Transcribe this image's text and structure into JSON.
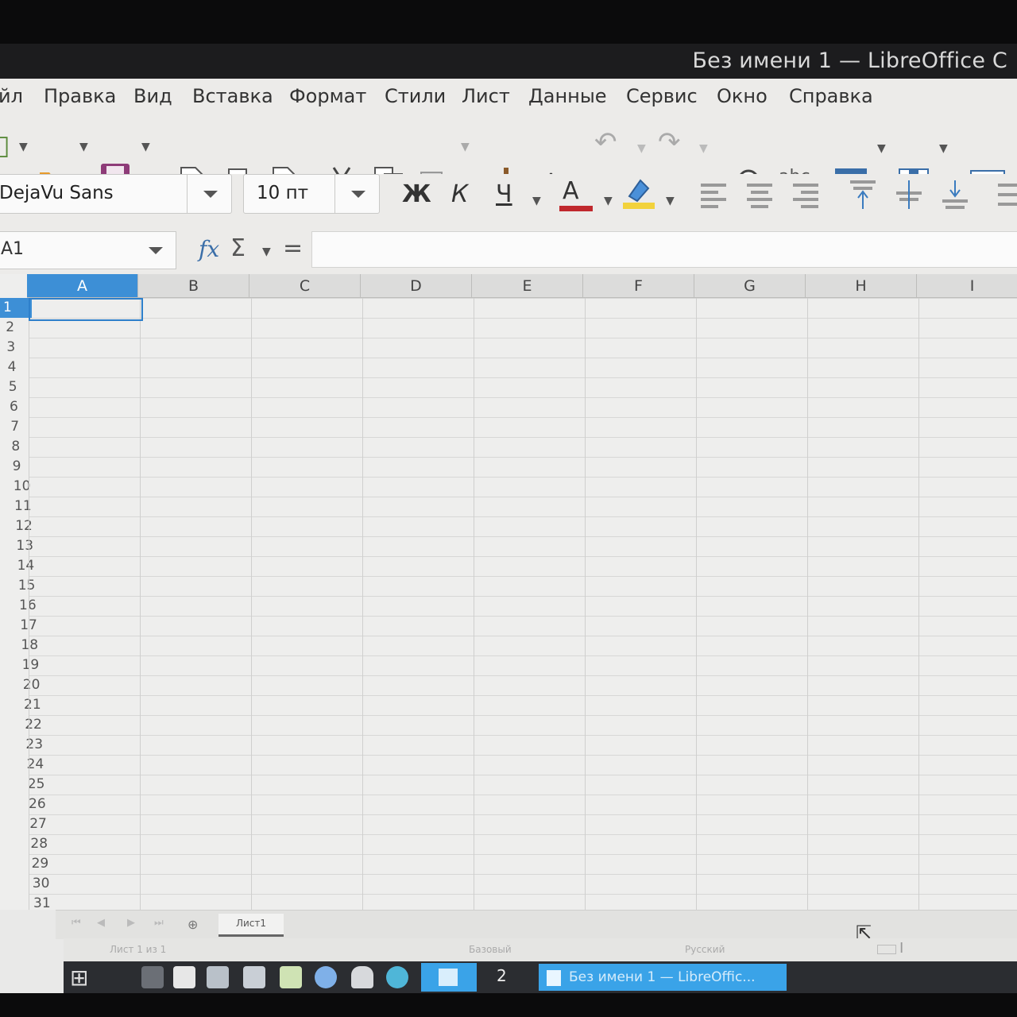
{
  "window": {
    "title": "Без имени 1 — LibreOffice C"
  },
  "menu": [
    "йл",
    "Правка",
    "Вид",
    "Вставка",
    "Формат",
    "Стили",
    "Лист",
    "Данные",
    "Сервис",
    "Окно",
    "Справка"
  ],
  "toolbar_icons": [
    "new-document-icon",
    "open-folder-icon",
    "save-icon",
    "export-pdf-icon",
    "print-icon",
    "print-preview-icon",
    "cut-icon",
    "copy-icon",
    "paste-icon",
    "clone-formatting-icon",
    "clear-formatting-icon",
    "undo-icon",
    "redo-icon",
    "find-replace-icon",
    "spellcheck-icon",
    "row-icon",
    "column-icon",
    "sort-icon"
  ],
  "formatting": {
    "font_name": "DejaVu Sans",
    "font_size": "10 пт",
    "bold_label": "Ж",
    "italic_label": "К",
    "underline_label": "Ч",
    "font_color_label": "A",
    "font_color": "#c0282d",
    "highlight_color": "#f2d23c"
  },
  "formula_bar": {
    "cell_ref": "A1",
    "function_wizard": "fx",
    "sum_symbol": "Σ",
    "equals_symbol": "=",
    "formula_value": ""
  },
  "grid": {
    "columns": [
      "A",
      "B",
      "C",
      "D",
      "E",
      "F",
      "G",
      "H",
      "I"
    ],
    "rows": [
      "1",
      "2",
      "3",
      "4",
      "5",
      "6",
      "7",
      "8",
      "9",
      "10",
      "11",
      "12",
      "13",
      "14",
      "15",
      "16",
      "17",
      "18",
      "19",
      "20",
      "21",
      "22",
      "23",
      "24",
      "25",
      "26",
      "27",
      "28",
      "29",
      "30",
      "31"
    ],
    "active_cell": "A1",
    "accent_color": "#3d8fd6"
  },
  "sheets": {
    "tabs": [
      "Лист1"
    ],
    "status_sheet": "Лист 1 из 1",
    "status_style": "Базовый",
    "status_language": "Русский"
  },
  "taskbar": {
    "workspace_number": "2",
    "active_window": "Без имени 1 — LibreOffic..."
  }
}
